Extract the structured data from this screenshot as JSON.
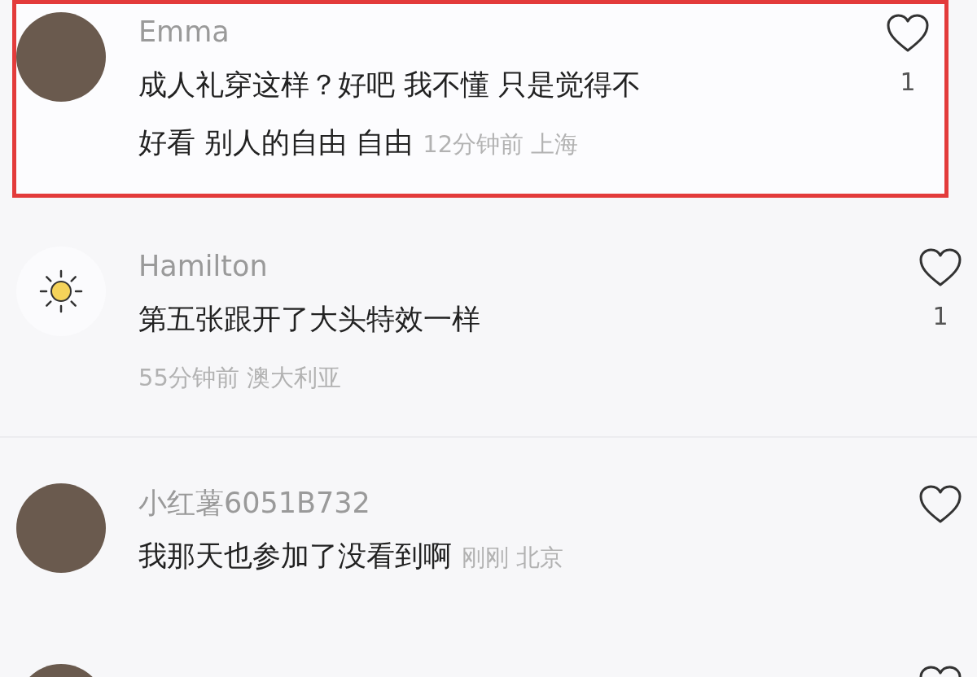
{
  "comments": [
    {
      "username": "Emma",
      "avatar": {
        "kind": "photo"
      },
      "text_lines": [
        "成人礼穿这样？好吧 我不懂 只是觉得不",
        "好看 别人的自由 自由"
      ],
      "meta": "12分钟前 上海",
      "meta_on_new_line": false,
      "like_count": "1",
      "highlighted": true
    },
    {
      "username": "Hamilton",
      "avatar": {
        "kind": "sun"
      },
      "text_lines": [
        "第五张跟开了大头特效一样"
      ],
      "meta": "55分钟前 澳大利亚",
      "meta_on_new_line": true,
      "like_count": "1",
      "highlighted": false
    },
    {
      "username": "小红薯6051B732",
      "avatar": {
        "kind": "photo"
      },
      "text_lines": [
        "我那天也参加了没看到啊"
      ],
      "meta": "刚刚 北京",
      "meta_on_new_line": false,
      "highlighted": false
    },
    {
      "avatar": {
        "kind": "photo"
      },
      "highlighted": false
    }
  ]
}
